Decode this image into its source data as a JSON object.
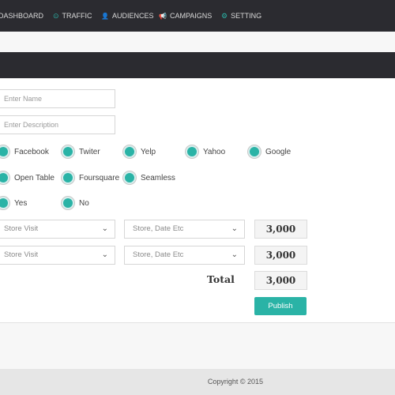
{
  "nav": {
    "items": [
      {
        "label": "DASHBOARD",
        "icon": "dashboard-icon",
        "glyph": ""
      },
      {
        "label": "TRAFFIC",
        "icon": "clock-icon",
        "glyph": "⊙"
      },
      {
        "label": "AUDIENCES",
        "icon": "user-icon",
        "glyph": "👤"
      },
      {
        "label": "CAMPAIGNS",
        "icon": "bullhorn-icon",
        "glyph": "📢"
      },
      {
        "label": "SETTING",
        "icon": "gear-icon",
        "glyph": "⚙"
      }
    ]
  },
  "form": {
    "name_placeholder": "Enter Name",
    "description_placeholder": "Enter Description",
    "platforms": [
      "Facebook",
      "Twiter",
      "Yelp",
      "Yahoo",
      "Google",
      "Open Table",
      "Foursquare",
      "Seamless"
    ],
    "yes_label": "Yes",
    "no_label": "No",
    "rows": [
      {
        "type": "Store Visit",
        "filter": "Store, Date Etc",
        "value": "3,000"
      },
      {
        "type": "Store Visit",
        "filter": "Store, Date Etc",
        "value": "3,000"
      }
    ],
    "total_label": "Total",
    "total_value": "3,000",
    "publish_label": "Publish"
  },
  "footer": {
    "copyright": "Copyright © 2015"
  },
  "colors": {
    "accent": "#2ab3a6",
    "nav_bg": "#2b2b30"
  }
}
